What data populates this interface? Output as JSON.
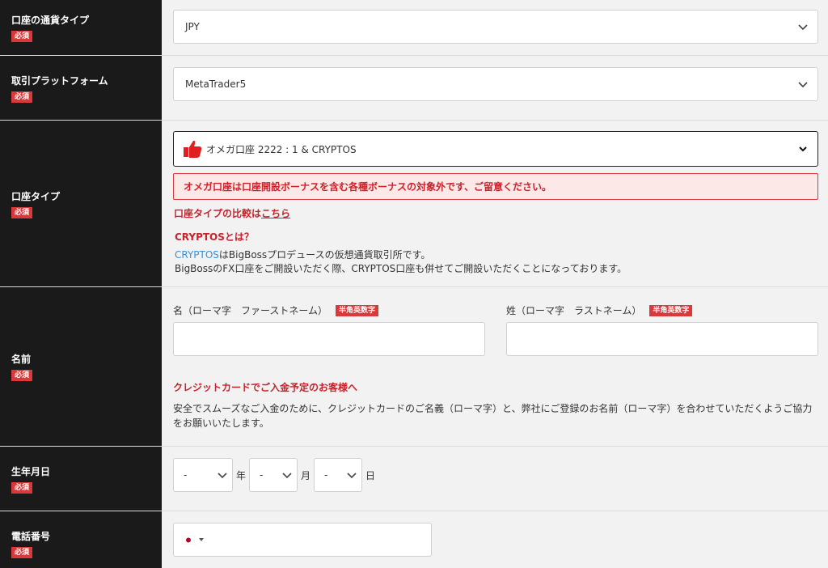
{
  "currency": {
    "label": "口座の通貨タイプ",
    "required": "必須",
    "value": "JPY"
  },
  "platform": {
    "label": "取引プラットフォーム",
    "required": "必須",
    "value": "MetaTrader5"
  },
  "account_type": {
    "label": "口座タイプ",
    "required": "必須",
    "value": "オメガ口座 2222 : 1 & CRYPTOS",
    "warning": "オメガ口座は口座開設ボーナスを含む各種ボーナスの対象外です、ご留意ください。",
    "compare_prefix": "口座タイプの比較は",
    "compare_link": "こちら",
    "cryptos_heading": "CRYPTOSとは？",
    "cryptos_link": "CRYPTOS",
    "desc1": "はBigBossプロデュースの仮想通貨取引所です。",
    "desc2": "BigBossのFX口座をご開設いただく際、CRYPTOS口座も併せてご開設いただくことになっております。"
  },
  "name": {
    "label": "名前",
    "required": "必須",
    "first_label": "名（ローマ字　ファーストネーム）",
    "last_label": "姓（ローマ字　ラストネーム）",
    "alnum_badge": "半角英数字",
    "first_value": "",
    "last_value": "",
    "card_heading": "クレジットカードでご入金予定のお客様へ",
    "card_desc1": "安全でスムーズなご入金のために、クレジットカードのご名義（ローマ字）と、弊社にご登録のお名前（ローマ字）を合わせていただくようご協力",
    "card_desc2": "をお願いいたします。"
  },
  "birthday": {
    "label": "生年月日",
    "required": "必須",
    "year_value": "-",
    "year_unit": "年",
    "month_value": "-",
    "month_unit": "月",
    "day_value": "-",
    "day_unit": "日"
  },
  "phone": {
    "label": "電話番号",
    "required": "必須",
    "value": ""
  },
  "colors": {
    "label_bg": "#1a1a1a",
    "accent_red": "#d9393a",
    "link_blue": "#3a8fd0"
  }
}
